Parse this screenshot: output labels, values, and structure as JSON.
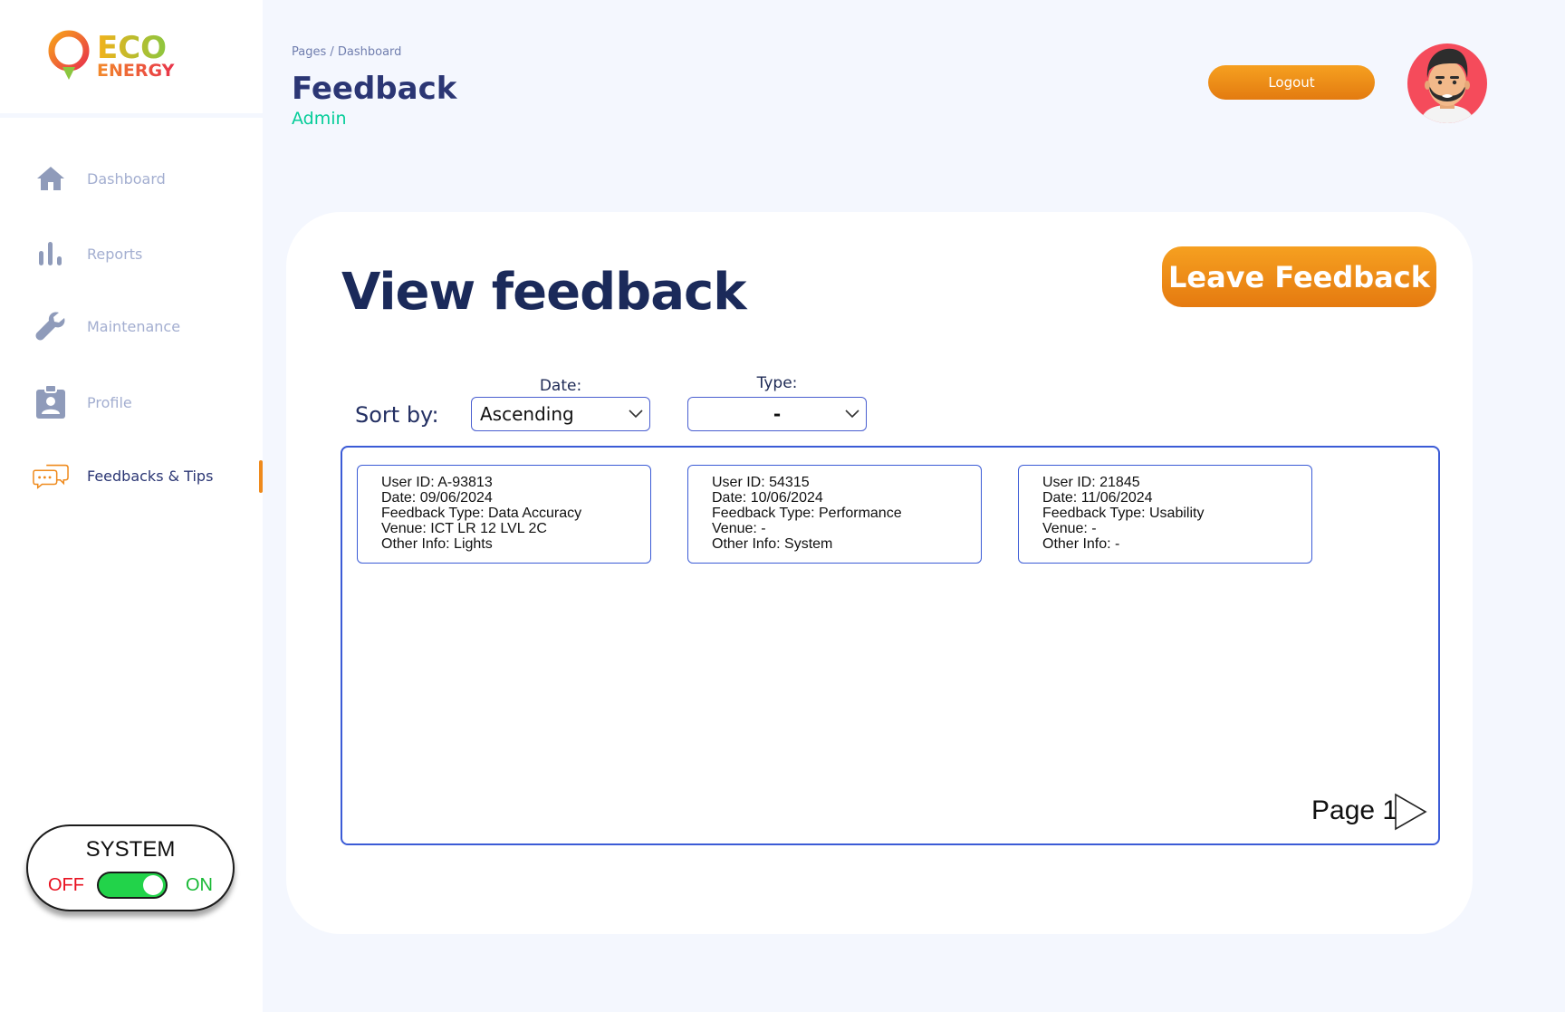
{
  "brand": {
    "line1": "ECO",
    "line2": "ENERGY"
  },
  "sidebar": {
    "items": [
      {
        "label": "Dashboard",
        "icon": "home-icon"
      },
      {
        "label": "Reports",
        "icon": "bar-chart-icon"
      },
      {
        "label": "Maintenance",
        "icon": "wrench-icon"
      },
      {
        "label": "Profile",
        "icon": "id-badge-icon"
      },
      {
        "label": "Feedbacks & Tips",
        "icon": "chat-bubbles-icon",
        "active": true
      }
    ]
  },
  "system": {
    "title": "SYSTEM",
    "off_label": "OFF",
    "on_label": "ON",
    "state": "on"
  },
  "header": {
    "breadcrumb": "Pages / Dashboard",
    "title": "Feedback",
    "role": "Admin",
    "logout_label": "Logout"
  },
  "main": {
    "title": "View feedback",
    "leave_feedback_label": "Leave Feedback",
    "sort_label": "Sort by:",
    "filters": {
      "date": {
        "label": "Date:",
        "value": "Ascending"
      },
      "type": {
        "label": "Type:",
        "value": "-"
      }
    },
    "feedback": [
      {
        "user_id": "User ID: A-93813",
        "date": "Date: 09/06/2024",
        "type": "Feedback Type: Data Accuracy",
        "venue": "Venue: ICT LR 12 LVL 2C",
        "other": "Other Info: Lights"
      },
      {
        "user_id": "User ID: 54315",
        "date": "Date: 10/06/2024",
        "type": "Feedback Type: Performance",
        "venue": "Venue: -",
        "other": "Other Info: System"
      },
      {
        "user_id": "User ID: 21845",
        "date": "Date: 11/06/2024",
        "type": "Feedback Type: Usability",
        "venue": "Venue: -",
        "other": "Other Info: -"
      }
    ],
    "page_label": "Page 1"
  },
  "colors": {
    "accent_orange": "#ef8a1c",
    "navy": "#2b3674",
    "green": "#05cd99",
    "border_blue": "#3b5bd6",
    "off_red": "#e8101f",
    "on_green": "#18b935"
  }
}
